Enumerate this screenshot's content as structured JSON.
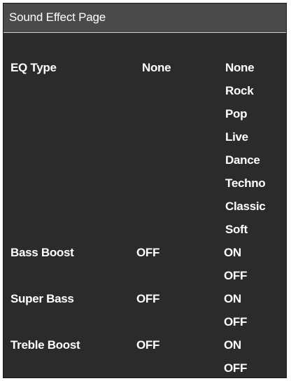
{
  "page": {
    "title": "Sound Effect Page"
  },
  "eq_type": {
    "label": "EQ Type",
    "value": "None",
    "options": [
      "None",
      "Rock",
      "Pop",
      "Live",
      "Dance",
      "Techno",
      "Classic",
      "Soft"
    ]
  },
  "bass_boost": {
    "label": "Bass Boost",
    "value": "OFF",
    "options": [
      "ON",
      "OFF"
    ]
  },
  "super_bass": {
    "label": "Super Bass",
    "value": "OFF",
    "options": [
      "ON",
      "OFF"
    ]
  },
  "treble_boost": {
    "label": "Treble Boost",
    "value": "OFF",
    "options": [
      "ON",
      "OFF"
    ]
  },
  "colors": {
    "background": "#2b2b2b",
    "title_bar": "#4a4a4a",
    "text": "#ffffff"
  }
}
